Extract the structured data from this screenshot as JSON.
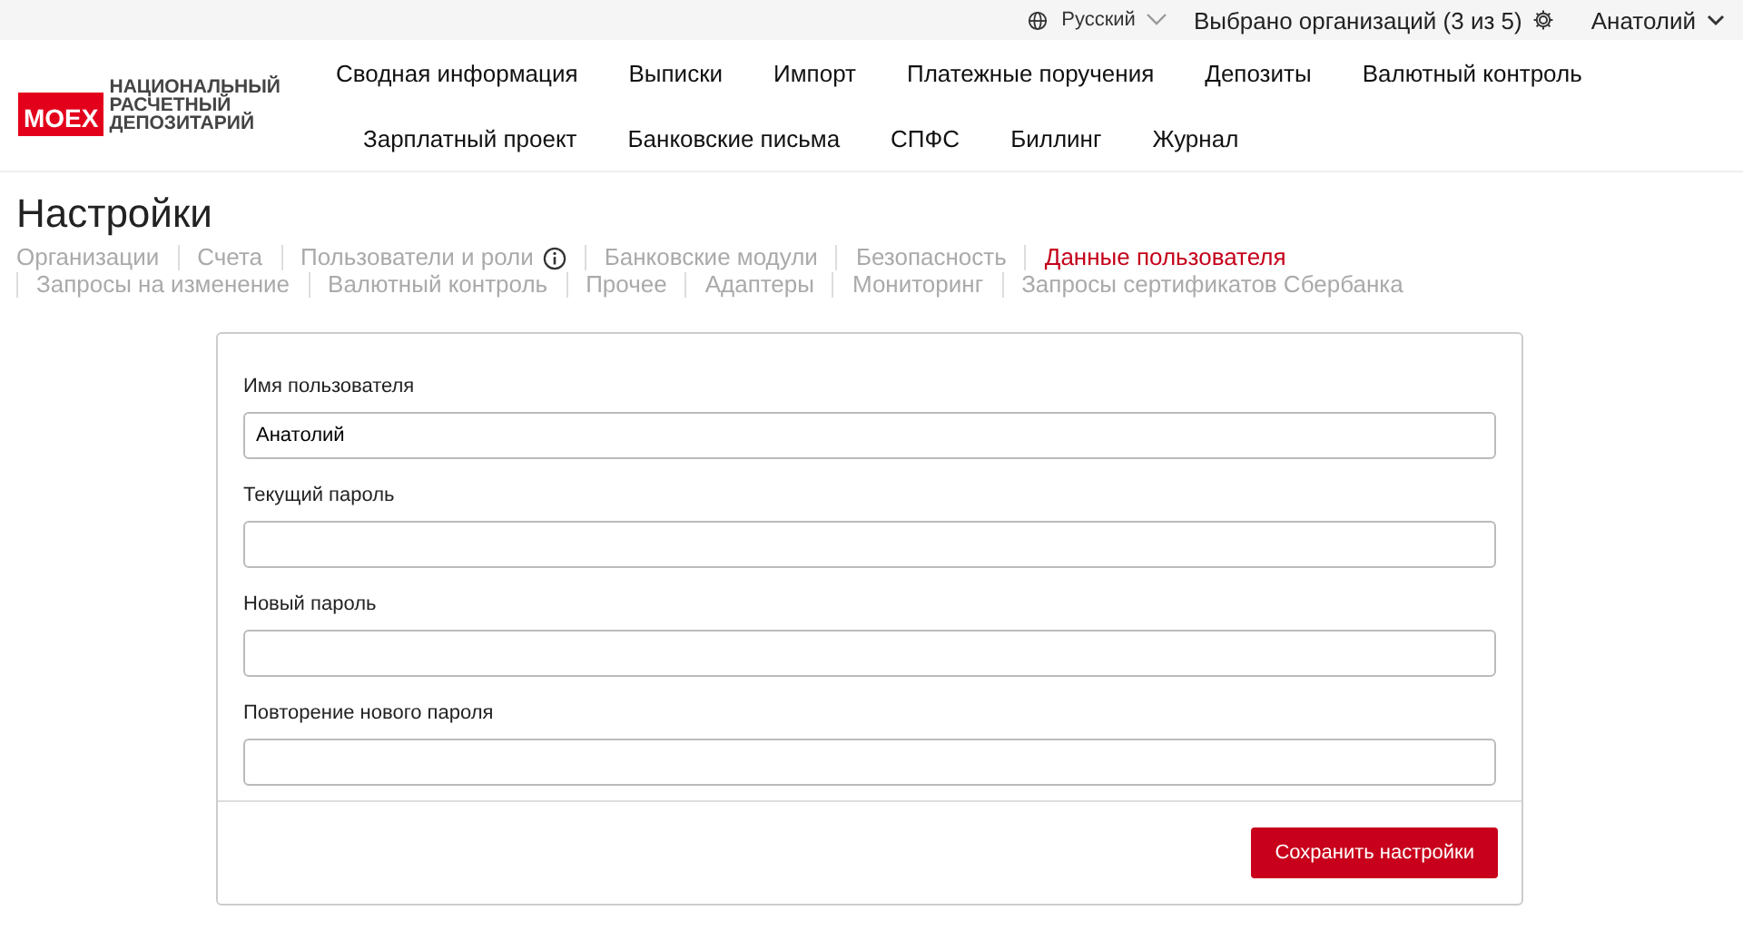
{
  "top_bar": {
    "language": "Русский",
    "organizations": "Выбрано организаций (3 из 5)",
    "user": "Анатолий"
  },
  "logo": {
    "badge": "MOEX",
    "lines": [
      "НАЦИОНАЛЬНЫЙ",
      "РАСЧЕТНЫЙ",
      "ДЕПОЗИТАРИЙ"
    ]
  },
  "nav": [
    [
      "Сводная информация",
      "Выписки",
      "Импорт",
      "Платежные поручения",
      "Депозиты",
      "Валютный контроль"
    ],
    [
      "Зарплатный проект",
      "Банковские письма",
      "СПФС",
      "Биллинг",
      "Журнал"
    ]
  ],
  "page_title": "Настройки",
  "tabs": [
    {
      "label": "Организации",
      "selected": false,
      "info": false
    },
    {
      "label": "Счета",
      "selected": false,
      "info": false
    },
    {
      "label": "Пользователи и роли",
      "selected": false,
      "info": true
    },
    {
      "label": "Банковские модули",
      "selected": false,
      "info": false
    },
    {
      "label": "Безопасность",
      "selected": false,
      "info": false
    },
    {
      "label": "Данные пользователя",
      "selected": true,
      "info": false
    },
    {
      "label": "Запросы на изменение",
      "selected": false,
      "info": false
    },
    {
      "label": "Валютный контроль",
      "selected": false,
      "info": false
    },
    {
      "label": "Прочее",
      "selected": false,
      "info": false
    },
    {
      "label": "Адаптеры",
      "selected": false,
      "info": false
    },
    {
      "label": "Мониторинг",
      "selected": false,
      "info": false
    },
    {
      "label": "Запросы сертификатов Сбербанка",
      "selected": false,
      "info": false
    }
  ],
  "form": {
    "fields": [
      {
        "label": "Имя пользователя",
        "value": "Анатолий"
      },
      {
        "label": "Текущий пароль"
      },
      {
        "label": "Новый пароль"
      },
      {
        "label": "Повторение нового пароля"
      }
    ],
    "save_button": "Сохранить настройки"
  }
}
